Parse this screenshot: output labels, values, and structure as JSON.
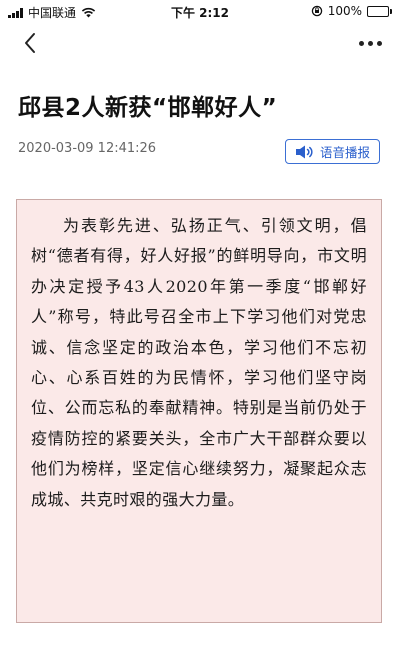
{
  "status_bar": {
    "carrier": "中国联通",
    "time": "下午 2:12",
    "battery_level": "100%",
    "battery_fill": 1.0,
    "battery_color": "#34c759"
  },
  "nav": {
    "back_icon": "chevron-left-icon",
    "more_icon": "more-dots-icon"
  },
  "article": {
    "title": "邱县2人新获“邯郸好人”",
    "timestamp": "2020-03-09 12:41:26",
    "audio_button_label": "语音播报",
    "body": "为表彰先进、弘扬正气、引领文明，倡树“德者有得，好人好报”的鲜明导向，市文明办决定授予43人2020年第一季度“邯郸好人”称号，特此号召全市上下学习他们对党忠诚、信念坚定的政治本色，学习他们不忘初心、心系百姓的为民情怀，学习他们坚守岗位、公而忘私的奉献精神。特别是当前仍处于疫情防控的紧要关头，全市广大干部群众要以他们为榜样，坚定信心继续努力，凝聚起众志成城、共克时艰的强大力量。"
  },
  "colors": {
    "accent_blue": "#2a5fcc",
    "box_background": "#fbe9e8",
    "box_border": "#c9a9a6"
  }
}
